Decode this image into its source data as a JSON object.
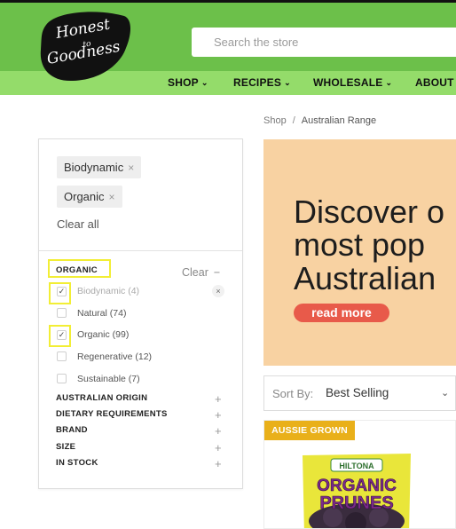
{
  "brand": {
    "logo_text_1": "Honest",
    "logo_text_2": "to",
    "logo_text_3": "Goodness"
  },
  "search": {
    "placeholder": "Search the store"
  },
  "nav": {
    "items": [
      {
        "label": "SHOP"
      },
      {
        "label": "RECIPES"
      },
      {
        "label": "WHOLESALE"
      },
      {
        "label": "ABOUT"
      }
    ]
  },
  "breadcrumb": {
    "home": "Shop",
    "separator": "/",
    "current": "Australian Range"
  },
  "active_filters": {
    "chips": [
      {
        "label": "Biodynamic"
      },
      {
        "label": "Organic"
      }
    ],
    "clear_all": "Clear all"
  },
  "facets": {
    "organic": {
      "title": "ORGANIC",
      "clear_label": "Clear",
      "options": [
        {
          "label": "Biodynamic (4)",
          "checked": true
        },
        {
          "label": "Natural (74)",
          "checked": false
        },
        {
          "label": "Organic (99)",
          "checked": true
        },
        {
          "label": "Regenerative (12)",
          "checked": false
        },
        {
          "label": "Sustainable (7)",
          "checked": false
        }
      ]
    },
    "collapsed": [
      {
        "title": "AUSTRALIAN ORIGIN"
      },
      {
        "title": "DIETARY REQUIREMENTS"
      },
      {
        "title": "BRAND"
      },
      {
        "title": "SIZE"
      },
      {
        "title": "IN STOCK"
      }
    ]
  },
  "banner": {
    "line1": "Discover o",
    "line2": "most pop",
    "line3": "Australian",
    "cta": "read more"
  },
  "sort": {
    "label": "Sort By:",
    "value": "Best Selling"
  },
  "product": {
    "badge": "AUSSIE GROWN",
    "package_brand": "HILTONA",
    "package_line1": "ORGANIC",
    "package_line2": "PRUNES"
  },
  "colors": {
    "header_green": "#6cc04a",
    "nav_green": "#94dc6a",
    "banner_peach": "#f8d2a2",
    "cta_red": "#e85a4a",
    "badge_gold": "#e9b01a",
    "highlight_yellow": "#f2ee35"
  }
}
